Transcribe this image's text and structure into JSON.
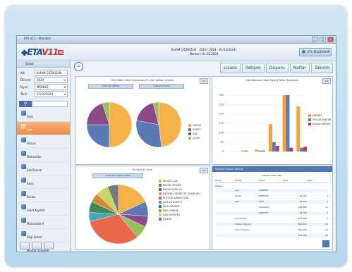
{
  "window": {
    "title": "ETA:V11 - Standart"
  },
  "brand": {
    "logo_prefix": "ETA",
    "logo_version": "V11",
    "logo_badge": "SQL",
    "company_line1": "İLHAM ÇİÇEKÇİLİK - 2019 / 2024 - 01/10/2024)",
    "company_line2": "Merkez / 01.03.2024",
    "user": "ETA BİLGİSAYAR"
  },
  "sidebar": {
    "header": "Şirket",
    "fields": [
      {
        "label": "Adı",
        "value": "İLHAM ÇİÇEKÇİLİK"
      },
      {
        "label": "Dönem",
        "value": "2024"
      },
      {
        "label": "İşyeri",
        "value": "MERKEZ"
      },
      {
        "label": "Tarih",
        "value": "17/10/2024"
      }
    ],
    "nav": [
      "Stok",
      "Cari",
      "Fatura",
      "Muhasebe",
      "Çek/Senet",
      "Kasa",
      "Banka",
      "Sabit Kıymet",
      "Muhasebe II",
      "Bilgi Şirket",
      "Müşteri İlişkileri"
    ],
    "active_index": 1
  },
  "topmenu": [
    "Lisans",
    "İletişim",
    "Duyuru",
    "Notlar",
    "Takvim"
  ],
  "panels": {
    "pie_panel": {
      "title": "Ödül Kodu Göre Gruplanmış En Çok Satılan Ürünler",
      "sub1": "TOPLAM MİKTAR",
      "sub2": "TOPLAM TUTAR",
      "tab": "1/4",
      "legend": [
        "TANGO",
        "SURET",
        "DAL",
        "ÇİÇEK"
      ],
      "colors": [
        "#f6b24a",
        "#5b79b7",
        "#8d4a88",
        "#9abf58"
      ]
    },
    "bar_panel": {
      "title": "Ödül Bulunan Göre Sipariş Takip Toplamları",
      "tab": "1/4",
      "legend": [
        "MİKTAR",
        "TESLİM MİKTAR",
        "KALAN MİKTAR"
      ],
      "colors": [
        "#f6a23a",
        "#5b79b7",
        "#b8405a"
      ],
      "yticks": [
        "300",
        "250",
        "200",
        "150",
        "100",
        "50",
        "0"
      ]
    },
    "pie2_panel": {
      "title": "En Kârlı 10 Ürün",
      "sub": "STOK NET SATIŞ TUTARI",
      "tab": "1/4",
      "legend": [
        "BEYAZ LALE",
        "BEYAZ ORKİDE",
        "BEYAZ PAPATYA",
        "DEĞERLİ SEMBİTTE DUNDÜRÜ",
        "KUTUDA KIRMIZI GÜL",
        "LEYLAK BUKETİ",
        "MOR ORKİDE",
        "MİNİ ORKİDE",
        "SARI PAPATYA",
        "ÇİÇEKE"
      ],
      "colors": [
        "#f6b24a",
        "#5b79b7",
        "#8d4a88",
        "#9abf58",
        "#e9684d",
        "#4aa3b9",
        "#3c8a56",
        "#d48a3a",
        "#c9d468",
        "#7a7a7a"
      ]
    },
    "grid_panel": {
      "title": "Pivotlar Raporu Kontrol",
      "header": "Gelecek Sütun Ekle",
      "labels": {
        "hesap": "Hesap",
        "tanim": "Tanım",
        "ozet": "Tutar",
        "adet": "Adet",
        "grup": "Grup Toplam",
        "toplam": "Genel Toplam",
        "firma": "Firma",
        "musteri": "Müşteri"
      },
      "rows": [
        {
          "a": "Çek",
          "b": "TANDEM",
          "c": "",
          "d": ""
        },
        {
          "a": "Senet",
          "b": "PORTFÖY",
          "c": "12 000",
          "d": "1"
        },
        {
          "a": "Çek",
          "b": "CİRO",
          "c": "40 000",
          "d": "3"
        },
        {
          "a": "",
          "b": "TAHSİLAT",
          "c": "381 800",
          "d": "10"
        },
        {
          "a": "",
          "b": "PORTFÖY",
          "c": "12 000",
          "d": "2"
        },
        {
          "a": "Çek Toplam",
          "b": "",
          "c": "250 000",
          "d": "5"
        },
        {
          "a": "Müşteri Toplam",
          "b": "",
          "c": "600 000",
          "d": "22"
        },
        {
          "a": "Genel Toplam",
          "b": "",
          "c": "900 000",
          "d": "25"
        },
        {
          "a": "",
          "b": "",
          "c": "677 000",
          "d": "26"
        }
      ]
    }
  },
  "chart_data": [
    {
      "type": "pie",
      "title": "TOPLAM MİKTAR",
      "labels": [
        "TANGO",
        "SURET",
        "DAL",
        "ÇİÇEK"
      ],
      "values": [
        50,
        25,
        20,
        5
      ]
    },
    {
      "type": "pie",
      "title": "TOPLAM TUTAR",
      "labels": [
        "TANGO",
        "SURET",
        "DAL",
        "ÇİÇEK"
      ],
      "values": [
        48,
        30,
        18,
        4
      ]
    },
    {
      "type": "bar",
      "categories": [
        "1",
        "2",
        "3",
        "4",
        "5",
        "6"
      ],
      "series": [
        {
          "name": "MİKTAR",
          "values": [
            0,
            5,
            10,
            145,
            330,
            240
          ]
        },
        {
          "name": "TESLİM MİKTAR",
          "values": [
            0,
            5,
            5,
            50,
            310,
            20
          ]
        },
        {
          "name": "KALAN MİKTAR",
          "values": [
            0,
            0,
            5,
            30,
            20,
            25
          ]
        }
      ],
      "ylim": [
        0,
        300
      ]
    },
    {
      "type": "pie",
      "title": "STOK NET SATIŞ TUTARI",
      "labels": [
        "BEYAZ LALE",
        "BEYAZ ORKİDE",
        "BEYAZ PAPATYA",
        "DEĞERLİ SEMBİTTE DUNDÜRÜ",
        "KUTUDA KIRMIZI GÜL",
        "LEYLAK BUKETİ",
        "MOR ORKİDE",
        "MİNİ ORKİDE",
        "SARI PAPATYA",
        "ÇİÇEKE"
      ],
      "values": [
        18,
        8,
        6,
        7,
        32,
        5,
        6,
        5,
        7,
        6
      ]
    }
  ]
}
